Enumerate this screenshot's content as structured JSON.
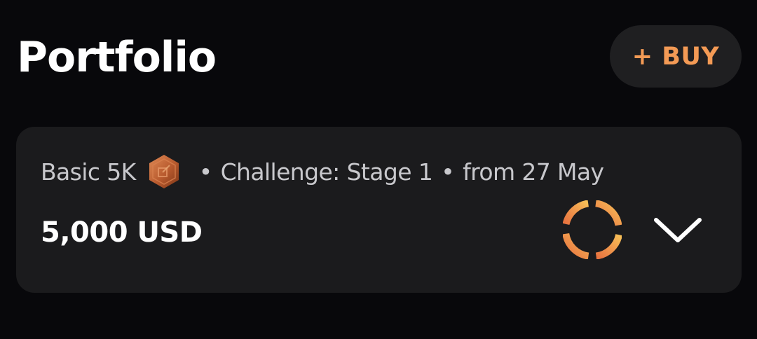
{
  "header": {
    "title": "Portfolio",
    "buy_label": "+ BUY"
  },
  "account": {
    "plan": "Basic 5K",
    "badge_icon": "bronze-hexagon-badge-icon",
    "separator": "•",
    "challenge": "Challenge: Stage 1",
    "start": "from 27 May",
    "balance": "5,000 USD",
    "progress_icon": "segmented-progress-ring-icon",
    "expand_icon": "chevron-down-icon"
  },
  "colors": {
    "background": "#08080b",
    "card": "#1b1b1d",
    "button": "#1f1f21",
    "accent": "#f39a55",
    "ring_start": "#e8733f",
    "ring_end": "#f7bf57",
    "badge": "#b85a2e",
    "text_primary": "#ffffff",
    "text_secondary": "#c8c8cc"
  }
}
